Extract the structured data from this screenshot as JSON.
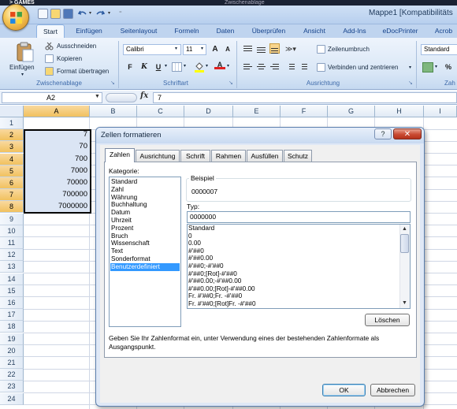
{
  "top_strip": {
    "left_label": "> GAMES",
    "ghost_label": "Zwischenablage"
  },
  "window": {
    "title": "Mappe1 [Kompatibilitäts"
  },
  "ribbon": {
    "tabs": [
      "Start",
      "Einfügen",
      "Seitenlayout",
      "Formeln",
      "Daten",
      "Überprüfen",
      "Ansicht",
      "Add-Ins",
      "eDocPrinter",
      "Acrob"
    ],
    "clipboard": {
      "paste_label": "Einfügen",
      "cut_label": "Ausschneiden",
      "copy_label": "Kopieren",
      "format_painter_label": "Format übertragen",
      "group_label": "Zwischenablage"
    },
    "font": {
      "font_name": "Calibri",
      "font_size": "11",
      "grow_label": "A",
      "shrink_label": "A",
      "bold_label": "F",
      "italic_label": "K",
      "underline_label": "U",
      "font_color_label": "A",
      "group_label": "Schriftart"
    },
    "alignment": {
      "wrap_label": "Zeilenumbruch",
      "merge_label": "Verbinden und zentrieren",
      "group_label": "Ausrichtung"
    },
    "number": {
      "format_value": "Standard",
      "percent_label": "%",
      "group_label": "Zah"
    }
  },
  "formula_bar": {
    "name_box": "A2",
    "fx_label": "fx",
    "value": "7"
  },
  "sheet": {
    "columns": [
      "A",
      "B",
      "C",
      "D",
      "E",
      "F",
      "G",
      "H",
      "I"
    ],
    "rows": [
      "1",
      "2",
      "3",
      "4",
      "5",
      "6",
      "7",
      "8",
      "9",
      "10",
      "11",
      "12",
      "13",
      "14",
      "15",
      "16",
      "17",
      "18",
      "19",
      "20",
      "21",
      "22",
      "23",
      "24"
    ],
    "column_a_values": [
      "7",
      "70",
      "700",
      "7000",
      "70000",
      "700000",
      "7000000"
    ]
  },
  "dialog": {
    "title": "Zellen formatieren",
    "help_label": "?",
    "close_label": "✕",
    "tabs": [
      "Zahlen",
      "Ausrichtung",
      "Schrift",
      "Rahmen",
      "Ausfüllen",
      "Schutz"
    ],
    "kategorie_label": "Kategorie:",
    "kategorien": [
      "Standard",
      "Zahl",
      "Währung",
      "Buchhaltung",
      "Datum",
      "Uhrzeit",
      "Prozent",
      "Bruch",
      "Wissenschaft",
      "Text",
      "Sonderformat",
      "Benutzerdefiniert"
    ],
    "selected_kategorie": "Benutzerdefiniert",
    "beispiel_label": "Beispiel",
    "beispiel_value": "0000007",
    "typ_label": "Typ:",
    "typ_value": "0000000",
    "typ_list": [
      "Standard",
      "0",
      "0.00",
      "#'##0",
      "#'##0.00",
      "#'##0;-#'##0",
      "#'##0;[Rot]-#'##0",
      "#'##0.00;-#'##0.00",
      "#'##0.00;[Rot]-#'##0.00",
      "Fr. #'##0;Fr. -#'##0",
      "Fr. #'##0;[Rot]Fr. -#'##0"
    ],
    "loeschen_label": "Löschen",
    "help_text": "Geben Sie Ihr Zahlenformat ein, unter Verwendung eines der bestehenden Zahlenformate als Ausgangspunkt.",
    "ok_label": "OK",
    "abbrechen_label": "Abbrechen"
  }
}
